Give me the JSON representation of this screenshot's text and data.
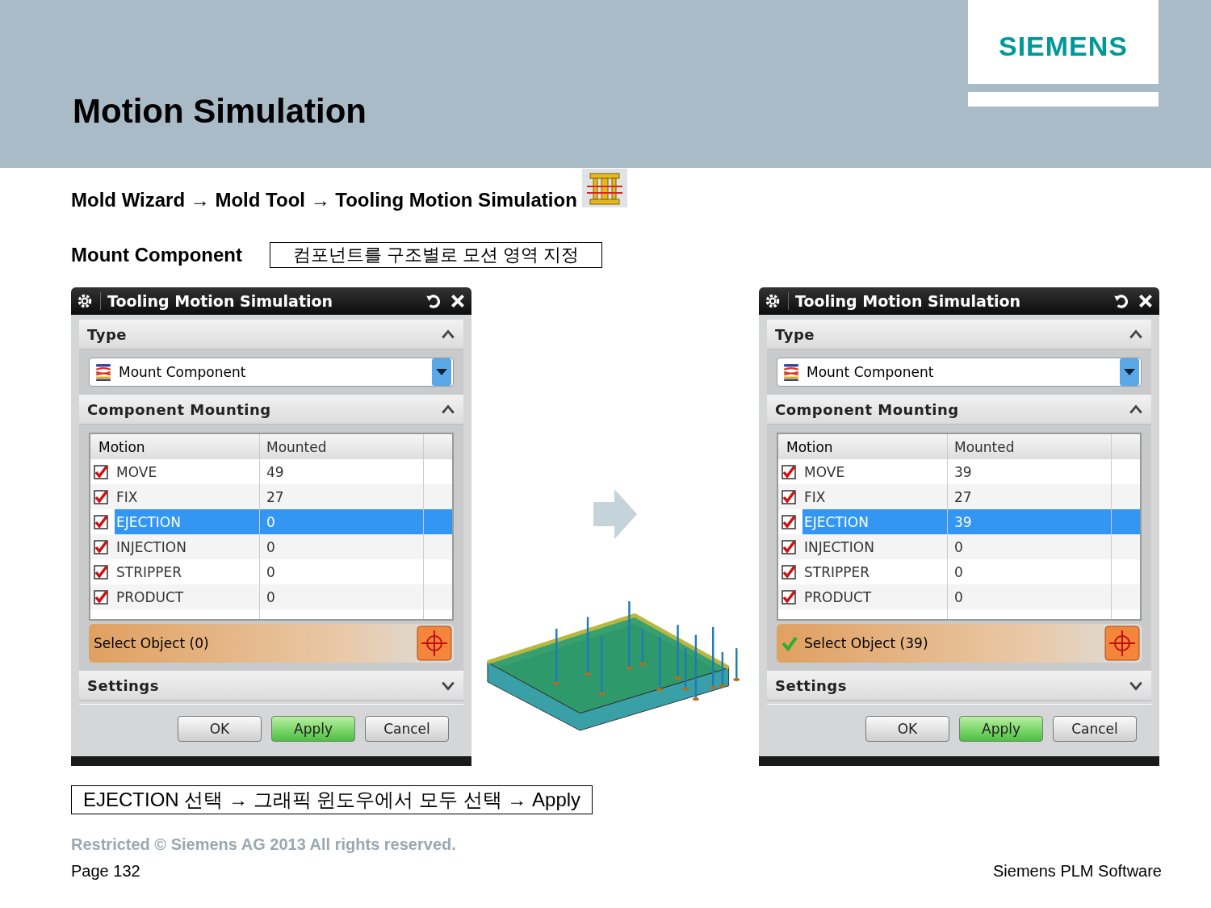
{
  "header": {
    "title": "Motion Simulation",
    "logo": "SIEMENS"
  },
  "breadcrumb": "Mold Wizard → Mold Tool → Tooling Motion Simulation",
  "mount": {
    "label": "Mount Component",
    "note": "컴포넌트를 구조별로 모션 영역 지정"
  },
  "dialogs": [
    {
      "title": "Tooling Motion Simulation",
      "type_section": {
        "title": "Type",
        "expanded": true,
        "value": "Mount Component"
      },
      "mounting_section": {
        "title": "Component Mounting",
        "expanded": true,
        "columns": [
          "Motion",
          "Mounted"
        ],
        "rows": [
          {
            "motion": "MOVE",
            "mounted": "49",
            "checked": true,
            "selected": false
          },
          {
            "motion": "FIX",
            "mounted": "27",
            "checked": true,
            "selected": false
          },
          {
            "motion": "EJECTION",
            "mounted": "0",
            "checked": true,
            "selected": true
          },
          {
            "motion": "INJECTION",
            "mounted": "0",
            "checked": true,
            "selected": false
          },
          {
            "motion": "STRIPPER",
            "mounted": "0",
            "checked": true,
            "selected": false
          },
          {
            "motion": "PRODUCT",
            "mounted": "0",
            "checked": true,
            "selected": false
          }
        ],
        "select_object": {
          "label": "Select Object (0)",
          "done": false
        }
      },
      "settings_section": {
        "title": "Settings",
        "expanded": false
      },
      "buttons": [
        {
          "label": "OK",
          "kind": "normal"
        },
        {
          "label": "Apply",
          "kind": "primary"
        },
        {
          "label": "Cancel",
          "kind": "normal"
        }
      ]
    },
    {
      "title": "Tooling Motion Simulation",
      "type_section": {
        "title": "Type",
        "expanded": true,
        "value": "Mount Component"
      },
      "mounting_section": {
        "title": "Component Mounting",
        "expanded": true,
        "columns": [
          "Motion",
          "Mounted"
        ],
        "rows": [
          {
            "motion": "MOVE",
            "mounted": "39",
            "checked": true,
            "selected": false
          },
          {
            "motion": "FIX",
            "mounted": "27",
            "checked": true,
            "selected": false
          },
          {
            "motion": "EJECTION",
            "mounted": "39",
            "checked": true,
            "selected": true
          },
          {
            "motion": "INJECTION",
            "mounted": "0",
            "checked": true,
            "selected": false
          },
          {
            "motion": "STRIPPER",
            "mounted": "0",
            "checked": true,
            "selected": false
          },
          {
            "motion": "PRODUCT",
            "mounted": "0",
            "checked": true,
            "selected": false
          }
        ],
        "select_object": {
          "label": "Select Object (39)",
          "done": true
        }
      },
      "settings_section": {
        "title": "Settings",
        "expanded": false
      },
      "buttons": [
        {
          "label": "OK",
          "kind": "normal"
        },
        {
          "label": "Apply",
          "kind": "primary"
        },
        {
          "label": "Cancel",
          "kind": "normal"
        }
      ]
    }
  ],
  "instruction": "EJECTION 선택 → 그래픽 윈도우에서 모두 선택 → Apply",
  "footer": {
    "copyright": "Restricted © Siemens AG 2013 All rights reserved.",
    "page": "Page 132",
    "company": "Siemens PLM Software"
  }
}
